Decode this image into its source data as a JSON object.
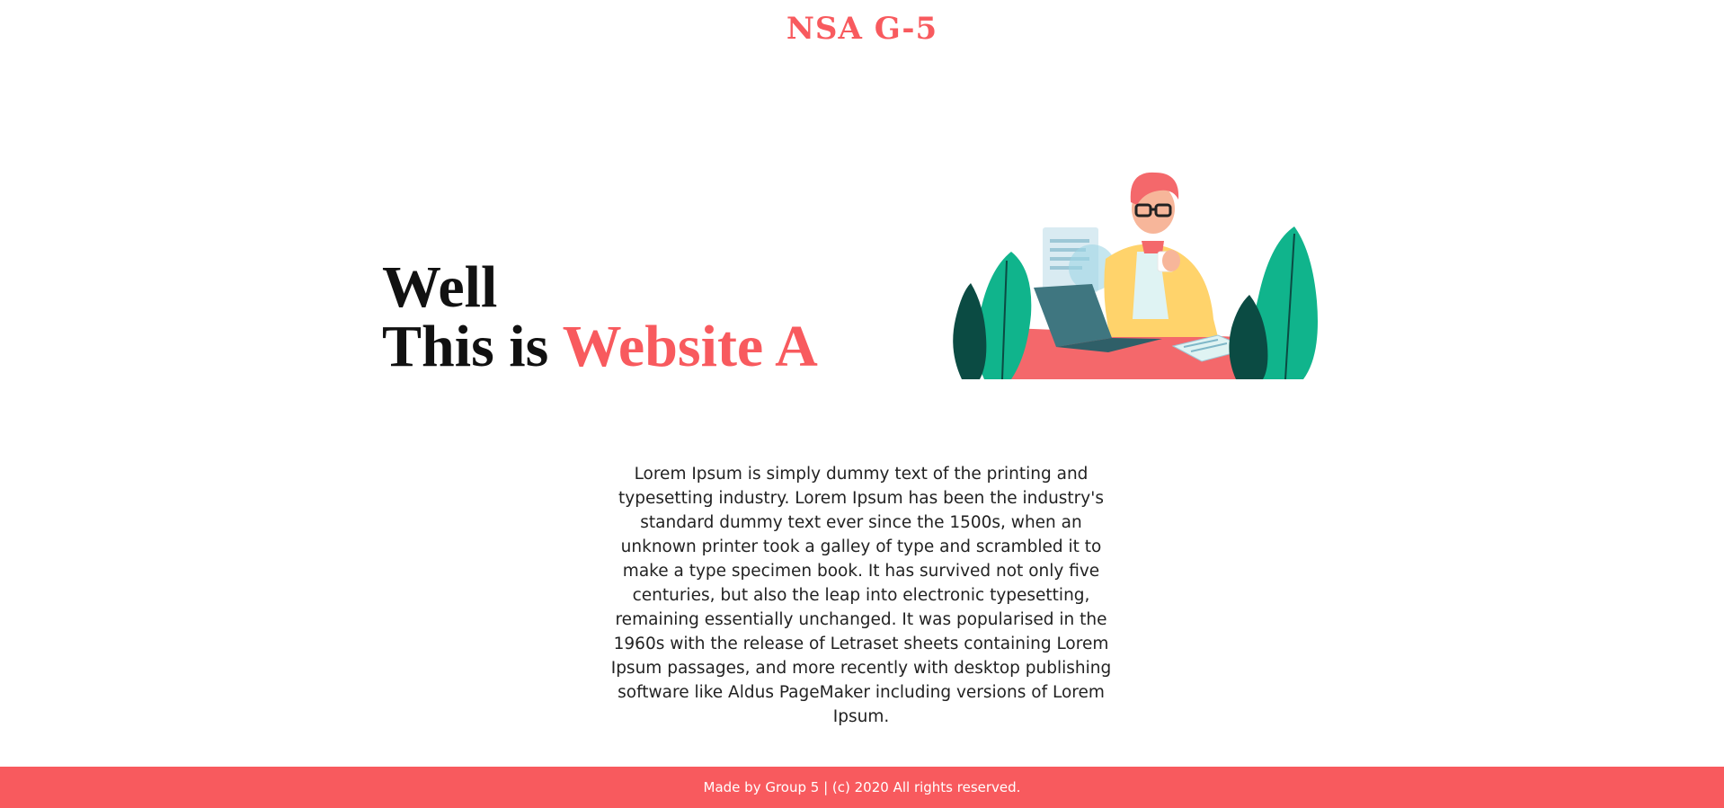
{
  "header": {
    "brand": "NSA G-5"
  },
  "hero": {
    "line1": "Well",
    "line2_prefix": "This is ",
    "line2_accent": "Website A",
    "illustration_icon": "person-at-laptop-with-plants-illustration"
  },
  "main": {
    "paragraph": "Lorem Ipsum is simply dummy text of the printing and typesetting industry. Lorem Ipsum has been the industry's standard dummy text ever since the 1500s, when an unknown printer took a galley of type and scrambled it to make a type specimen book. It has survived not only five centuries, but also the leap into electronic typesetting, remaining essentially unchanged. It was popularised in the 1960s with the release of Letraset sheets containing Lorem Ipsum passages, and more recently with desktop publishing software like Aldus PageMaker including versions of Lorem Ipsum."
  },
  "footer": {
    "text": "Made by Group 5 | (c) 2020 All rights reserved."
  },
  "colors": {
    "accent": "#f85a5e",
    "text_dark": "#111111",
    "plant_green": "#10b48c",
    "plant_dark": "#0b4b43",
    "shirt_yellow": "#ffd36b",
    "laptop": "#3f7680"
  }
}
